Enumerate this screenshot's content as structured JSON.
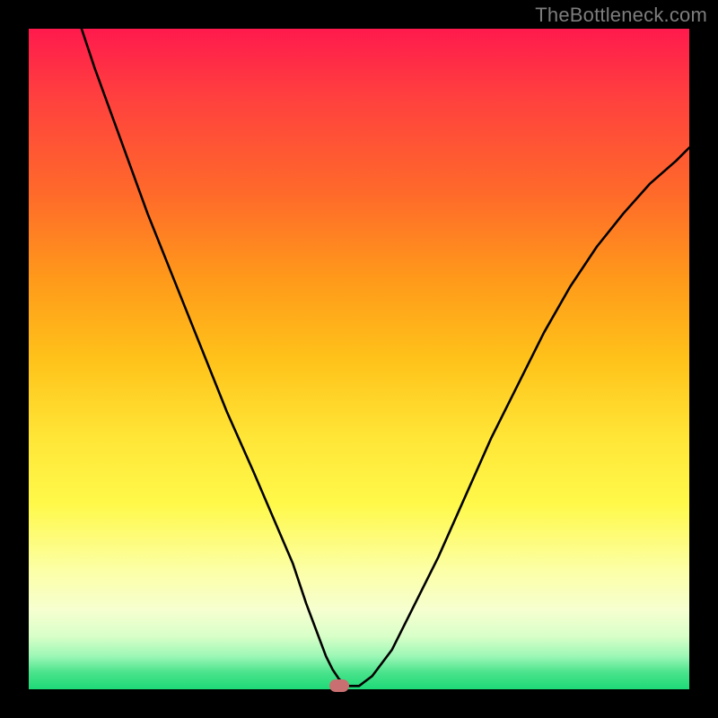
{
  "watermark": "TheBottleneck.com",
  "chart_data": {
    "type": "line",
    "title": "",
    "xlabel": "",
    "ylabel": "",
    "xlim": [
      0,
      100
    ],
    "ylim": [
      0,
      100
    ],
    "grid": false,
    "legend": false,
    "series": [
      {
        "name": "curve",
        "x": [
          8,
          10,
          14,
          18,
          22,
          26,
          30,
          34,
          37,
          40,
          42,
          43.5,
          45,
          46,
          47,
          48.5,
          50,
          52,
          55,
          58,
          62,
          66,
          70,
          74,
          78,
          82,
          86,
          90,
          94,
          98,
          100
        ],
        "y": [
          100,
          94,
          83,
          72,
          62,
          52,
          42,
          33,
          26,
          19,
          13,
          9,
          5,
          3,
          1.5,
          0.5,
          0.5,
          2,
          6,
          12,
          20,
          29,
          38,
          46,
          54,
          61,
          67,
          72,
          76.5,
          80,
          82
        ]
      }
    ],
    "marker": {
      "x": 47,
      "y": 0.5,
      "color": "#c96f71"
    },
    "background_gradient": {
      "top": "#ff1a4d",
      "bottom": "#1ed977"
    },
    "frame_color": "#000000"
  }
}
